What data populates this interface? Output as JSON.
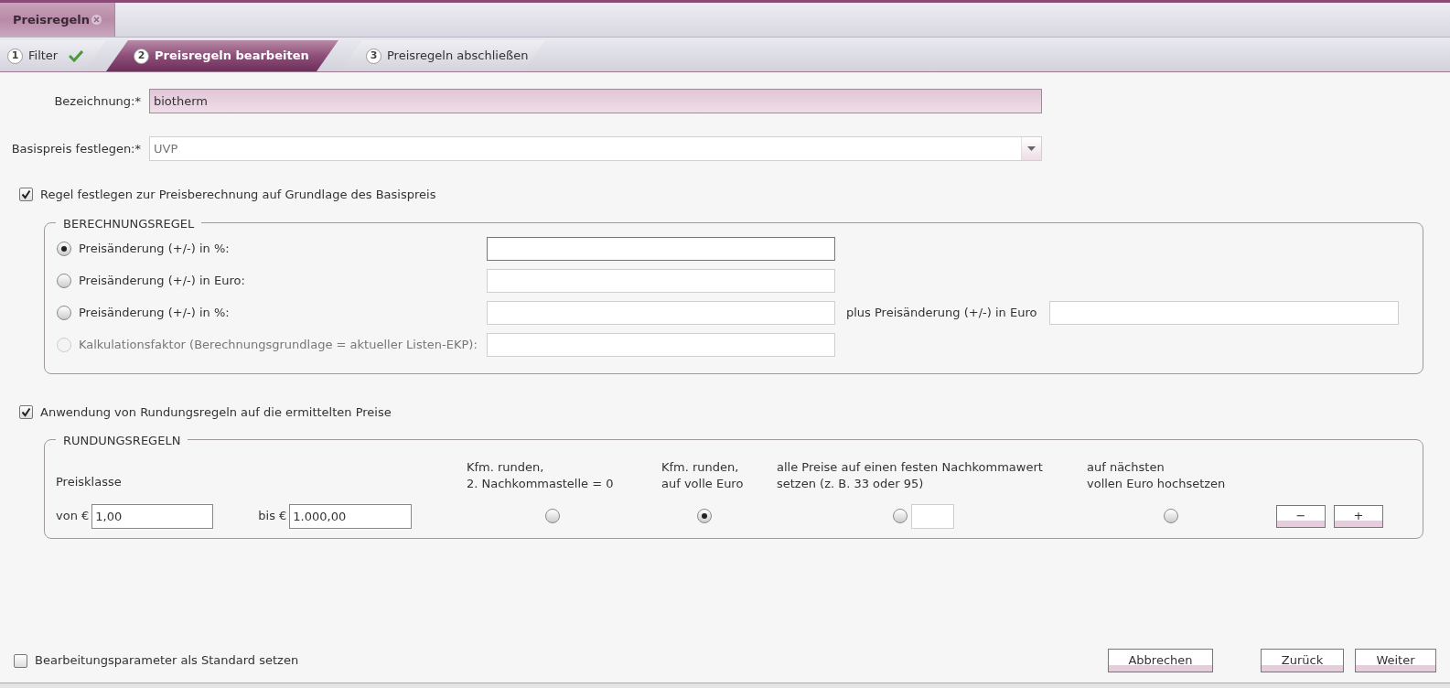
{
  "document_tabs": [
    {
      "label": "Preisregeln",
      "selected": true
    }
  ],
  "wizard_steps": [
    {
      "number": "1",
      "label": "Filter",
      "selected": false,
      "completed": true
    },
    {
      "number": "2",
      "label": "Preisregeln bearbeiten",
      "selected": true,
      "completed": false
    },
    {
      "number": "3",
      "label": "Preisregeln abschließen",
      "selected": false,
      "completed": false
    }
  ],
  "fields": [
    {
      "kind": "text",
      "label": "Bezeichnung:*",
      "value": "biotherm"
    },
    {
      "kind": "select",
      "label": "Basispreis festlegen:*",
      "value": "UVP"
    }
  ],
  "price_rule": {
    "checkbox": {
      "label": "Regel festlegen zur Preisberechnung auf Grundlage des Basispreis",
      "checked": true
    },
    "legend": "BERECHNUNGSREGEL",
    "options": [
      {
        "label": "Preisänderung (+/-) in %:",
        "selected": true,
        "disabled": false
      },
      {
        "label": "Preisänderung (+/-) in Euro:",
        "selected": false,
        "disabled": false
      },
      {
        "label": "Preisänderung (+/-) in %:",
        "selected": false,
        "disabled": false,
        "extra_label": "plus Preisänderung (+/-) in Euro"
      },
      {
        "label": "Kalkulationsfaktor (Berechnungsgrundlage = aktueller Listen-EKP):",
        "selected": false,
        "disabled": true
      }
    ]
  },
  "rounding": {
    "checkbox": {
      "label": "Anwendung von Rundungsregeln auf die ermittelten Preise",
      "checked": true
    },
    "legend": "RUNDUNGSREGELN",
    "price_class_label": "Preisklasse",
    "columns": [
      {
        "kind": "radio",
        "heading": "Kfm. runden,\n2. Nachkommastelle = 0"
      },
      {
        "kind": "radio",
        "heading": "Kfm. runden,\nauf volle Euro"
      },
      {
        "kind": "radio_with_input",
        "heading": "alle Preise auf einen festen Nachkommawert\nsetzen (z. B. 33 oder 95)"
      },
      {
        "kind": "radio",
        "heading": "auf nächsten\nvollen Euro hochsetzen"
      }
    ],
    "rows": [
      {
        "from_label": "von €",
        "from_value": "1,00",
        "to_label": "bis €",
        "to_value": "1.000,00",
        "choices": [
          {
            "selected": false
          },
          {
            "selected": true
          },
          {
            "selected": false
          },
          {
            "selected": false
          }
        ]
      }
    ],
    "row_buttons": [
      "−",
      "+"
    ]
  },
  "footer": {
    "checkbox": {
      "label": "Bearbeitungsparameter als Standard setzen",
      "checked": false
    },
    "buttons": [
      "Abbrechen",
      "Zurück",
      "Weiter"
    ]
  }
}
